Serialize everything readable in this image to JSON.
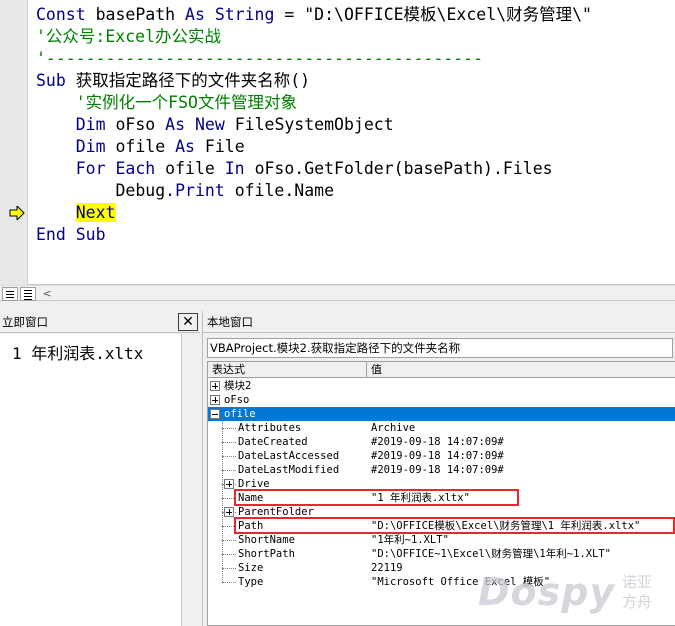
{
  "editor": {
    "lines": [
      {
        "parts": [
          {
            "t": "Const ",
            "c": "kw"
          },
          {
            "t": "basePath ",
            "c": ""
          },
          {
            "t": "As String",
            "c": "kw"
          },
          {
            "t": " = \"D:\\OFFICE模板\\Excel\\财务管理\\\"",
            "c": ""
          }
        ]
      },
      {
        "parts": [
          {
            "t": "'公众号:Excel办公实战",
            "c": "cm"
          }
        ]
      },
      {
        "parts": [
          {
            "t": "'--------------------------------------------",
            "c": "cm"
          }
        ]
      },
      {
        "parts": [
          {
            "t": "Sub ",
            "c": "kw"
          },
          {
            "t": "获取指定路径下的文件夹名称()",
            "c": ""
          }
        ]
      },
      {
        "parts": [
          {
            "t": "    '实例化一个FSO文件管理对象",
            "c": "cm"
          }
        ]
      },
      {
        "parts": [
          {
            "t": "    Dim ",
            "c": "kw"
          },
          {
            "t": "oFso ",
            "c": ""
          },
          {
            "t": "As New ",
            "c": "kw"
          },
          {
            "t": "FileSystemObject",
            "c": ""
          }
        ]
      },
      {
        "parts": [
          {
            "t": "    Dim ",
            "c": "kw"
          },
          {
            "t": "ofile ",
            "c": ""
          },
          {
            "t": "As ",
            "c": "kw"
          },
          {
            "t": "File",
            "c": ""
          }
        ]
      },
      {
        "parts": [
          {
            "t": "    For Each ",
            "c": "kw"
          },
          {
            "t": "ofile ",
            "c": ""
          },
          {
            "t": "In ",
            "c": "kw"
          },
          {
            "t": "oFso.GetFolder(basePath).Files",
            "c": ""
          }
        ]
      },
      {
        "parts": [
          {
            "t": "        Debug",
            "c": ""
          },
          {
            "t": ".Print ",
            "c": "kw"
          },
          {
            "t": "ofile.Name",
            "c": ""
          }
        ]
      },
      {
        "parts": [
          {
            "t": "    ",
            "c": ""
          },
          {
            "t": "Next",
            "c": "kw hl"
          }
        ]
      },
      {
        "parts": [
          {
            "t": "End Sub",
            "c": "kw"
          }
        ]
      }
    ]
  },
  "immediate": {
    "title": "立即窗口",
    "close_label": "✕",
    "text": "1 年利润表.xltx"
  },
  "locals": {
    "title": "本地窗口",
    "context": "VBAProject.模块2.获取指定路径下的文件夹名称",
    "headers": {
      "expression": "表达式",
      "value": "值"
    },
    "rows": [
      {
        "expr": "模块2",
        "value": "",
        "level": 0,
        "box": "plus"
      },
      {
        "expr": "oFso",
        "value": "",
        "level": 0,
        "box": "plus"
      },
      {
        "expr": "ofile",
        "value": "",
        "level": 0,
        "box": "minus",
        "selected": true
      },
      {
        "expr": "Attributes",
        "value": "Archive",
        "level": 1,
        "box": ""
      },
      {
        "expr": "DateCreated",
        "value": "#2019-09-18 14:07:09#",
        "level": 1,
        "box": ""
      },
      {
        "expr": "DateLastAccessed",
        "value": "#2019-09-18 14:07:09#",
        "level": 1,
        "box": ""
      },
      {
        "expr": "DateLastModified",
        "value": "#2019-09-18 14:07:09#",
        "level": 1,
        "box": ""
      },
      {
        "expr": "Drive",
        "value": "",
        "level": 1,
        "box": "plus"
      },
      {
        "expr": "Name",
        "value": "\"1 年利润表.xltx\"",
        "level": 1,
        "box": "",
        "highlight": true
      },
      {
        "expr": "ParentFolder",
        "value": "",
        "level": 1,
        "box": "plus"
      },
      {
        "expr": "Path",
        "value": "\"D:\\OFFICE模板\\Excel\\财务管理\\1 年利润表.xltx\"",
        "level": 1,
        "box": "",
        "highlight": true
      },
      {
        "expr": "ShortName",
        "value": "\"1年利~1.XLT\"",
        "level": 1,
        "box": ""
      },
      {
        "expr": "ShortPath",
        "value": "\"D:\\OFFICE~1\\Excel\\财务管理\\1年利~1.XLT\"",
        "level": 1,
        "box": ""
      },
      {
        "expr": "Size",
        "value": "22119",
        "level": 1,
        "box": ""
      },
      {
        "expr": "Type",
        "value": "\"Microsoft Office Excel 模板\"",
        "level": 1,
        "box": ""
      }
    ]
  },
  "watermark": {
    "brand": "Dospy",
    "cn": "诺亚方舟"
  }
}
